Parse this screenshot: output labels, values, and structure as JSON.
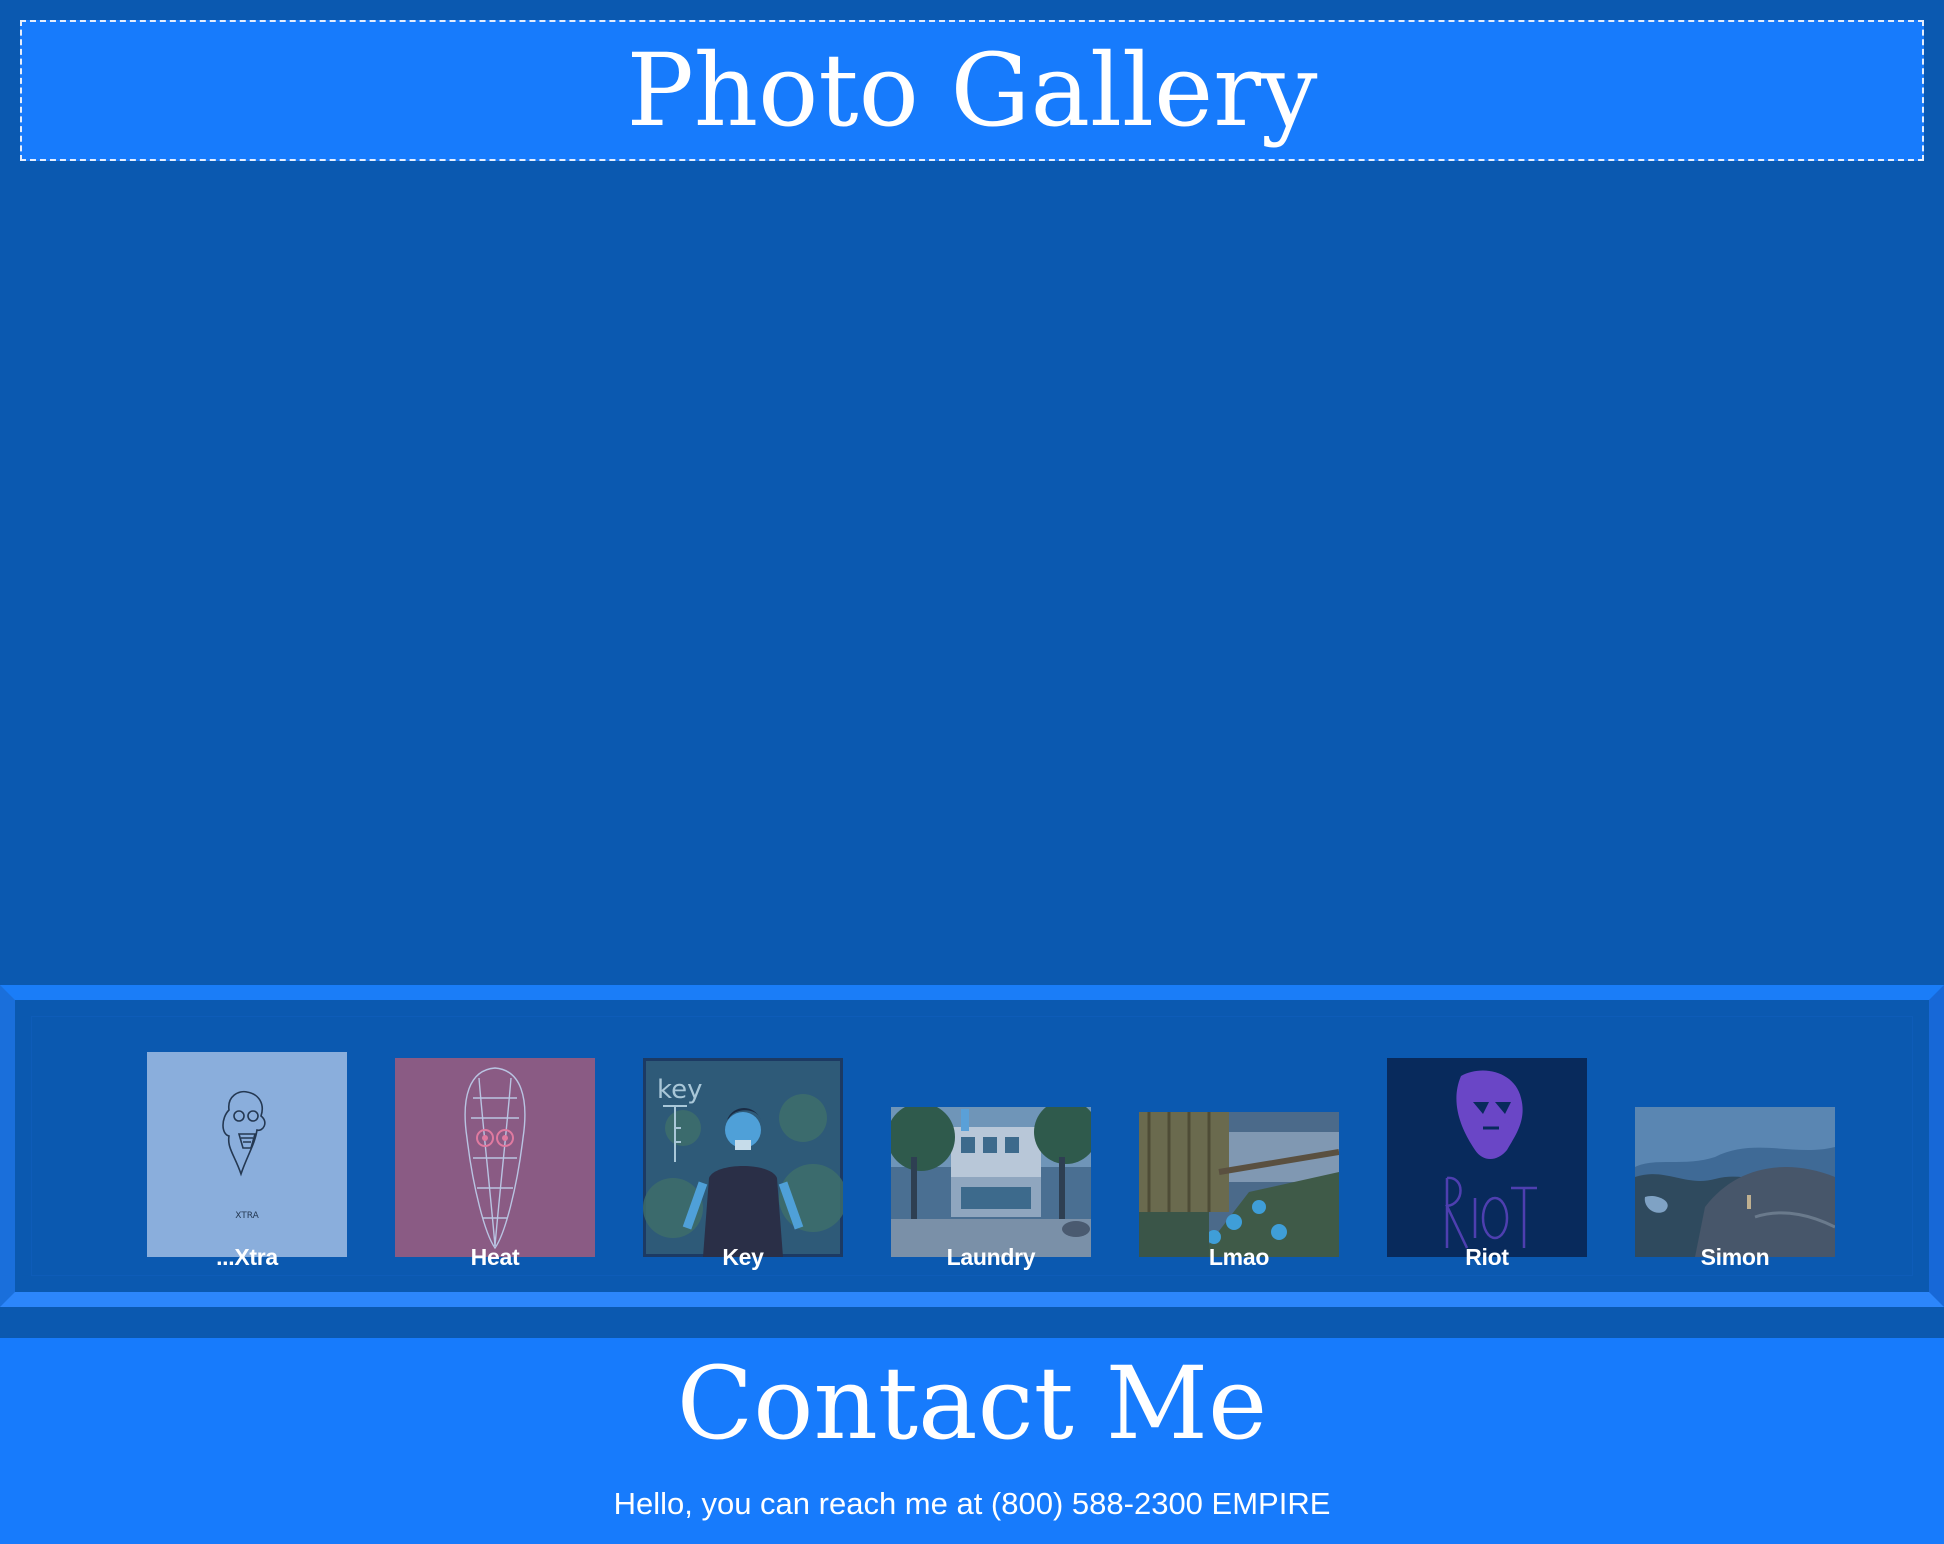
{
  "gallery": {
    "title": "Photo Gallery"
  },
  "thumbnails": [
    {
      "caption": "...Xtra",
      "icon": "xtra-artwork-thumbnail"
    },
    {
      "caption": "Heat",
      "icon": "heat-artwork-thumbnail"
    },
    {
      "caption": "Key",
      "icon": "key-artwork-thumbnail"
    },
    {
      "caption": "Laundry",
      "icon": "laundry-photo-thumbnail"
    },
    {
      "caption": "Lmao",
      "icon": "lmao-photo-thumbnail"
    },
    {
      "caption": "Riot",
      "icon": "riot-artwork-thumbnail"
    },
    {
      "caption": "Simon",
      "icon": "simon-photo-thumbnail"
    }
  ],
  "contact": {
    "title": "Contact Me",
    "text": "Hello, you can reach me at (800) 588-2300 EMPIRE"
  },
  "colors": {
    "background": "#0b59b0",
    "accent": "#177bfc",
    "text": "#ffffff"
  }
}
